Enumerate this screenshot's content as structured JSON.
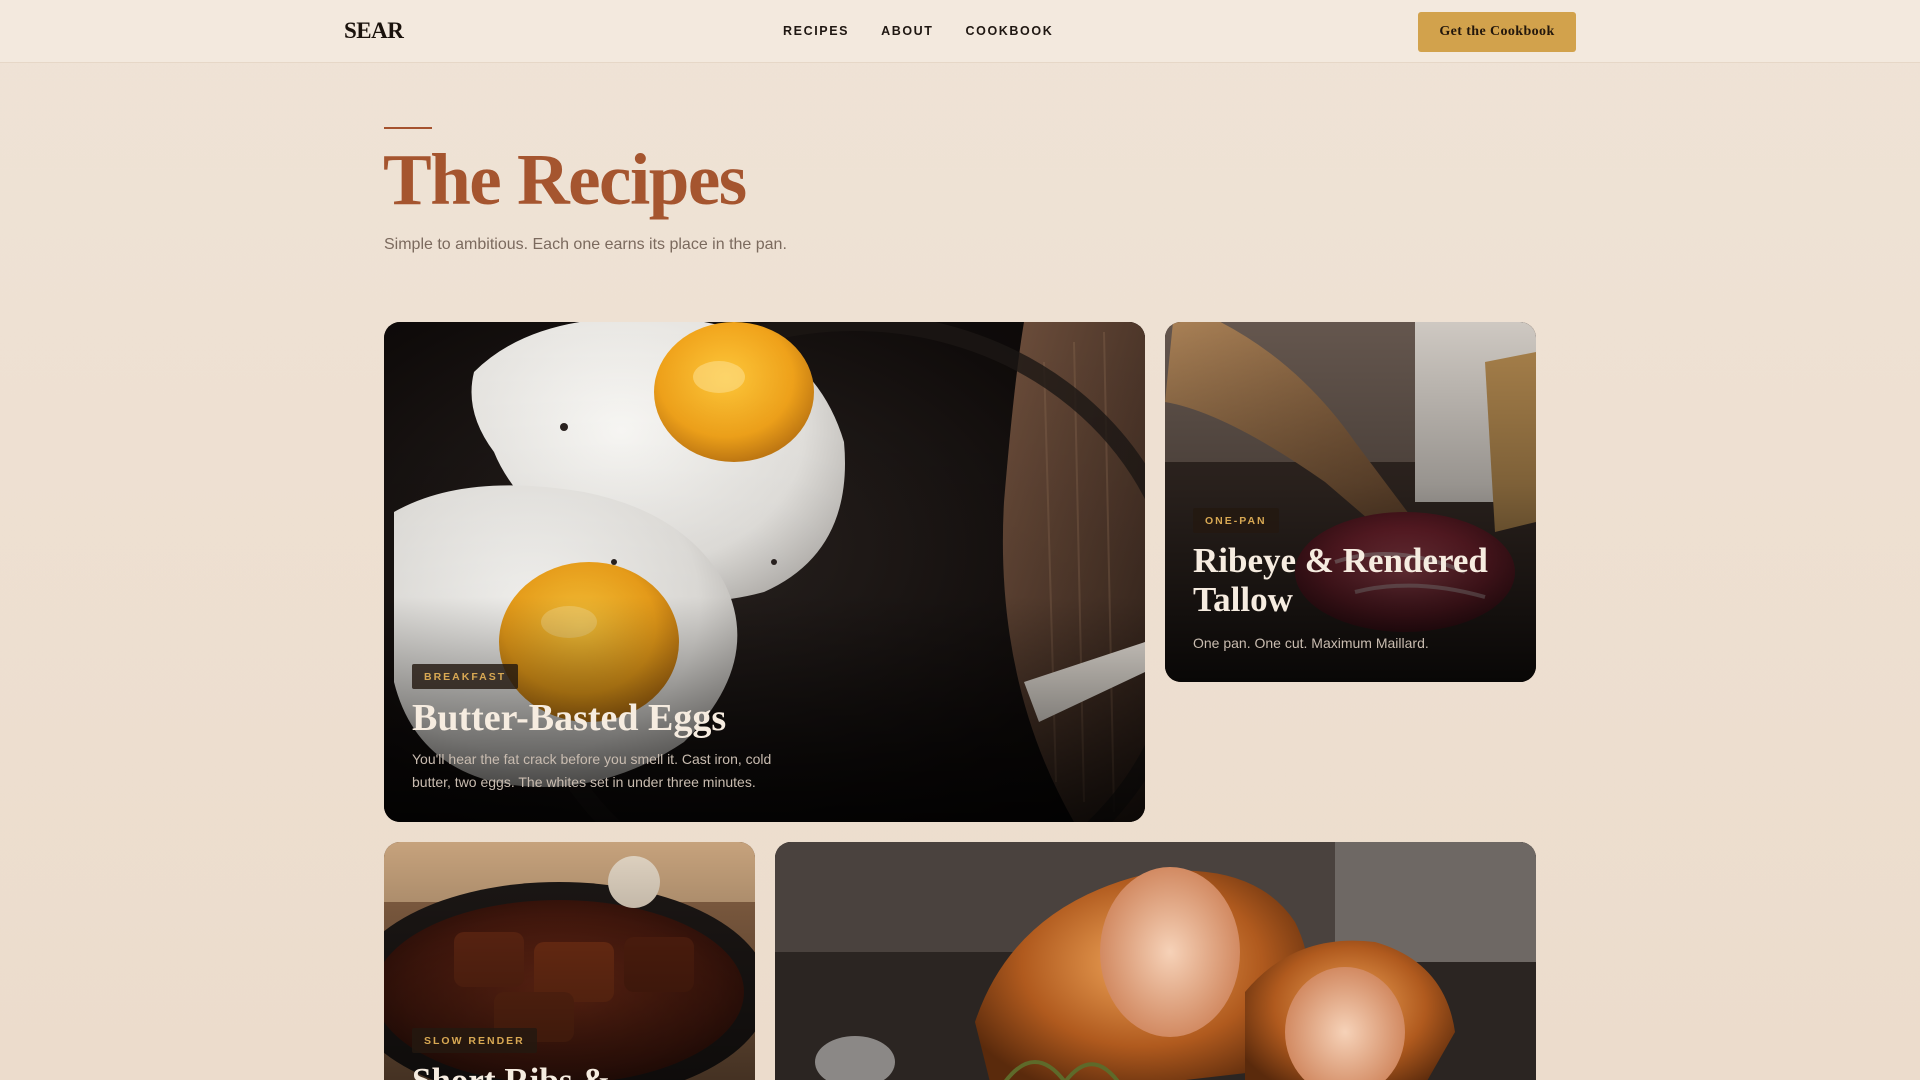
{
  "brand": {
    "logo": "SEAR"
  },
  "nav": {
    "items": [
      {
        "label": "RECIPES"
      },
      {
        "label": "ABOUT"
      },
      {
        "label": "COOKBOOK"
      }
    ],
    "cta_label": "Get the Cookbook"
  },
  "hero": {
    "title": "The Recipes",
    "subtitle": "Simple to ambitious. Each one earns its place in the pan."
  },
  "cards": [
    {
      "tag": "BREAKFAST",
      "title": "Butter-Basted Eggs",
      "description": "You'll hear the fat crack before you smell it. Cast iron, cold butter, two eggs. The whites set in under three minutes."
    },
    {
      "tag": "ONE-PAN",
      "title": "Ribeye & Rendered Tallow",
      "description": "One pan. One cut. Maximum Maillard."
    },
    {
      "tag": "SLOW RENDER",
      "title": "Short Ribs &"
    },
    {
      "tag": "",
      "title": ""
    }
  ],
  "colors": {
    "page_bg": "#eedfd0",
    "header_bg": "#f3e9de",
    "accent_rust": "#a5552f",
    "cta_gold": "#d2a24c",
    "tag_text": "#d8a853"
  }
}
